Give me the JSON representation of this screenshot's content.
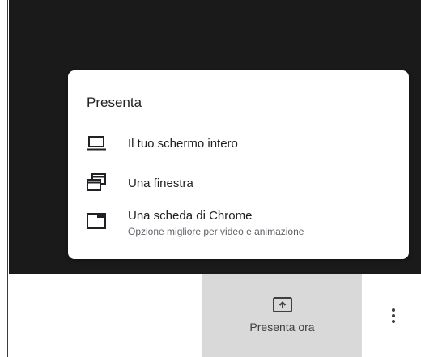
{
  "menu": {
    "title": "Presenta",
    "items": [
      {
        "icon": "laptop-icon",
        "label": "Il tuo schermo intero"
      },
      {
        "icon": "window-icon",
        "label": "Una finestra"
      },
      {
        "icon": "tab-icon",
        "label": "Una scheda di Chrome",
        "sublabel": "Opzione migliore per video e animazione"
      }
    ]
  },
  "bottom_bar": {
    "present_now_label": "Presenta ora",
    "present_icon": "present-to-all-icon",
    "more_icon": "more-vert-icon"
  },
  "colors": {
    "background_dark": "#1a1a1a",
    "present_button_bg": "#d9d9d9",
    "text_primary": "#202124",
    "text_secondary": "#5f6368"
  }
}
